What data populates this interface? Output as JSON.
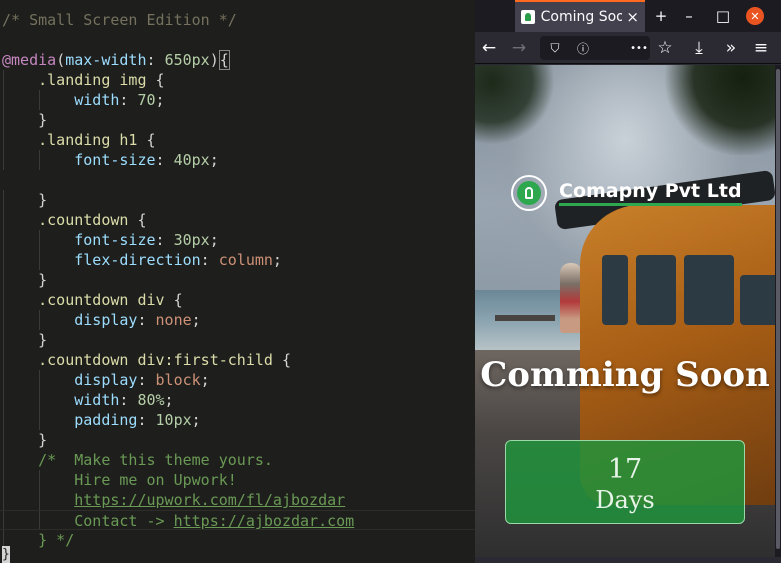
{
  "editor": {
    "lines": [
      {
        "indent": 0,
        "tokens": [
          {
            "c": "t-comment",
            "t": "/* Small Screen Edition */"
          }
        ]
      },
      {
        "indent": 0,
        "tokens": []
      },
      {
        "indent": 0,
        "tokens": [
          {
            "c": "t-at",
            "t": "@media"
          },
          {
            "c": "t-punc",
            "t": "("
          },
          {
            "c": "t-prop",
            "t": "max-width"
          },
          {
            "c": "t-punc",
            "t": ": "
          },
          {
            "c": "t-num",
            "t": "650px"
          },
          {
            "c": "t-punc",
            "t": ")"
          },
          {
            "c": "t-punc bracket-box",
            "t": "{"
          }
        ]
      },
      {
        "indent": 1,
        "tokens": [
          {
            "c": "t-sel",
            "t": ".landing img "
          },
          {
            "c": "t-punc",
            "t": "{"
          }
        ]
      },
      {
        "indent": 2,
        "tokens": [
          {
            "c": "t-prop",
            "t": "width"
          },
          {
            "c": "t-punc",
            "t": ": "
          },
          {
            "c": "t-num",
            "t": "70"
          },
          {
            "c": "t-punc",
            "t": ";"
          }
        ]
      },
      {
        "indent": 1,
        "tokens": [
          {
            "c": "t-punc",
            "t": "}"
          }
        ]
      },
      {
        "indent": 1,
        "tokens": [
          {
            "c": "t-sel",
            "t": ".landing h1 "
          },
          {
            "c": "t-punc",
            "t": "{"
          }
        ]
      },
      {
        "indent": 2,
        "tokens": [
          {
            "c": "t-prop",
            "t": "font-size"
          },
          {
            "c": "t-punc",
            "t": ": "
          },
          {
            "c": "t-num",
            "t": "40px"
          },
          {
            "c": "t-punc",
            "t": ";"
          }
        ]
      },
      {
        "indent": 0,
        "tokens": []
      },
      {
        "indent": 1,
        "tokens": [
          {
            "c": "t-punc",
            "t": "}"
          }
        ]
      },
      {
        "indent": 1,
        "tokens": [
          {
            "c": "t-sel",
            "t": ".countdown "
          },
          {
            "c": "t-punc",
            "t": "{"
          }
        ]
      },
      {
        "indent": 2,
        "tokens": [
          {
            "c": "t-prop",
            "t": "font-size"
          },
          {
            "c": "t-punc",
            "t": ": "
          },
          {
            "c": "t-num",
            "t": "30px"
          },
          {
            "c": "t-punc",
            "t": ";"
          }
        ]
      },
      {
        "indent": 2,
        "tokens": [
          {
            "c": "t-prop",
            "t": "flex-direction"
          },
          {
            "c": "t-punc",
            "t": ": "
          },
          {
            "c": "t-kw",
            "t": "column"
          },
          {
            "c": "t-punc",
            "t": ";"
          }
        ]
      },
      {
        "indent": 1,
        "tokens": [
          {
            "c": "t-punc",
            "t": "}"
          }
        ]
      },
      {
        "indent": 1,
        "tokens": [
          {
            "c": "t-sel",
            "t": ".countdown div "
          },
          {
            "c": "t-punc",
            "t": "{"
          }
        ]
      },
      {
        "indent": 2,
        "tokens": [
          {
            "c": "t-prop",
            "t": "display"
          },
          {
            "c": "t-punc",
            "t": ": "
          },
          {
            "c": "t-kw",
            "t": "none"
          },
          {
            "c": "t-punc",
            "t": ";"
          }
        ]
      },
      {
        "indent": 1,
        "tokens": [
          {
            "c": "t-punc",
            "t": "}"
          }
        ]
      },
      {
        "indent": 1,
        "tokens": [
          {
            "c": "t-sel",
            "t": ".countdown div:first-child "
          },
          {
            "c": "t-punc",
            "t": "{"
          }
        ]
      },
      {
        "indent": 2,
        "tokens": [
          {
            "c": "t-prop",
            "t": "display"
          },
          {
            "c": "t-punc",
            "t": ": "
          },
          {
            "c": "t-kw",
            "t": "block"
          },
          {
            "c": "t-punc",
            "t": ";"
          }
        ]
      },
      {
        "indent": 2,
        "tokens": [
          {
            "c": "t-prop",
            "t": "width"
          },
          {
            "c": "t-punc",
            "t": ": "
          },
          {
            "c": "t-num",
            "t": "80%"
          },
          {
            "c": "t-punc",
            "t": ";"
          }
        ]
      },
      {
        "indent": 2,
        "tokens": [
          {
            "c": "t-prop",
            "t": "padding"
          },
          {
            "c": "t-punc",
            "t": ": "
          },
          {
            "c": "t-num",
            "t": "10px"
          },
          {
            "c": "t-punc",
            "t": ";"
          }
        ]
      },
      {
        "indent": 1,
        "tokens": [
          {
            "c": "t-punc",
            "t": "}"
          }
        ]
      },
      {
        "indent": 1,
        "tokens": [
          {
            "c": "t-comment-green",
            "t": "/*  Make this theme yours."
          }
        ]
      },
      {
        "indent": 2,
        "tokens": [
          {
            "c": "t-comment-green",
            "t": "Hire me on Upwork!"
          }
        ]
      },
      {
        "indent": 2,
        "tokens": [
          {
            "c": "t-link",
            "t": "https://upwork.com/fl/ajbozdar"
          }
        ]
      },
      {
        "indent": 2,
        "current": true,
        "tokens": [
          {
            "c": "t-comment-green",
            "t": "Contact -> "
          },
          {
            "c": "t-link",
            "t": "https://ajbozdar.com"
          }
        ]
      },
      {
        "indent": 1,
        "tokens": [
          {
            "c": "t-comment-green",
            "t": "} */"
          }
        ]
      }
    ],
    "last_char": "}"
  },
  "browser": {
    "tab_title": "Coming Soon",
    "tab_close": "×",
    "new_tab": "+",
    "minimize": "–",
    "maximize": "□",
    "close": "✕",
    "nav": {
      "back": "←",
      "forward": "→",
      "shield": "⛉",
      "info": "ⓘ",
      "more": "•••",
      "bookmark": "☆",
      "download": "⤓",
      "overflow": "»",
      "menu": "≡"
    }
  },
  "page": {
    "company": "Comapny Pvt Ltd",
    "headline": "Comming Soon",
    "countdown": {
      "value": "17",
      "unit": "Days"
    }
  },
  "colors": {
    "accent_green": "#2ea84f",
    "tab_highlight": "#ff6a1f",
    "window_close": "#e95420"
  }
}
